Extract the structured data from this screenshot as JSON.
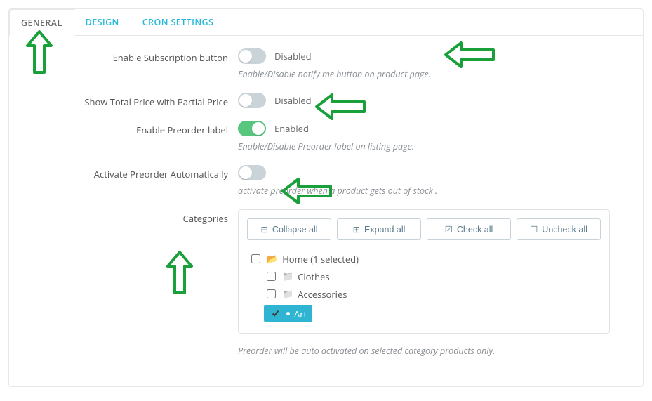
{
  "tabs": {
    "general": "GENERAL",
    "design": "DESIGN",
    "cron": "CRON SETTINGS"
  },
  "fields": {
    "subscription": {
      "label": "Enable Subscription button",
      "state": "Disabled",
      "enabled": false,
      "help": "Enable/Disable notify me button on product page."
    },
    "partial_price": {
      "label": "Show Total Price with Partial Price",
      "state": "Disabled",
      "enabled": false
    },
    "preorder_label": {
      "label": "Enable Preorder label",
      "state": "Enabled",
      "enabled": true,
      "help": "Enable/Disable Preorder label on listing page."
    },
    "auto_activate": {
      "label": "Activate Preorder Automatically",
      "state": "",
      "enabled": false,
      "help": "activate preorder when a product gets out of stock ."
    },
    "categories": {
      "label": "Categories",
      "toolbar": {
        "collapse": "Collapse all",
        "expand": "Expand all",
        "check": "Check all",
        "uncheck": "Uncheck all"
      },
      "tree": {
        "home_label": "Home (1 selected)",
        "clothes": "Clothes",
        "accessories": "Accessories",
        "art": "Art"
      },
      "help": "Preorder will be auto activated on selected category products only."
    }
  }
}
